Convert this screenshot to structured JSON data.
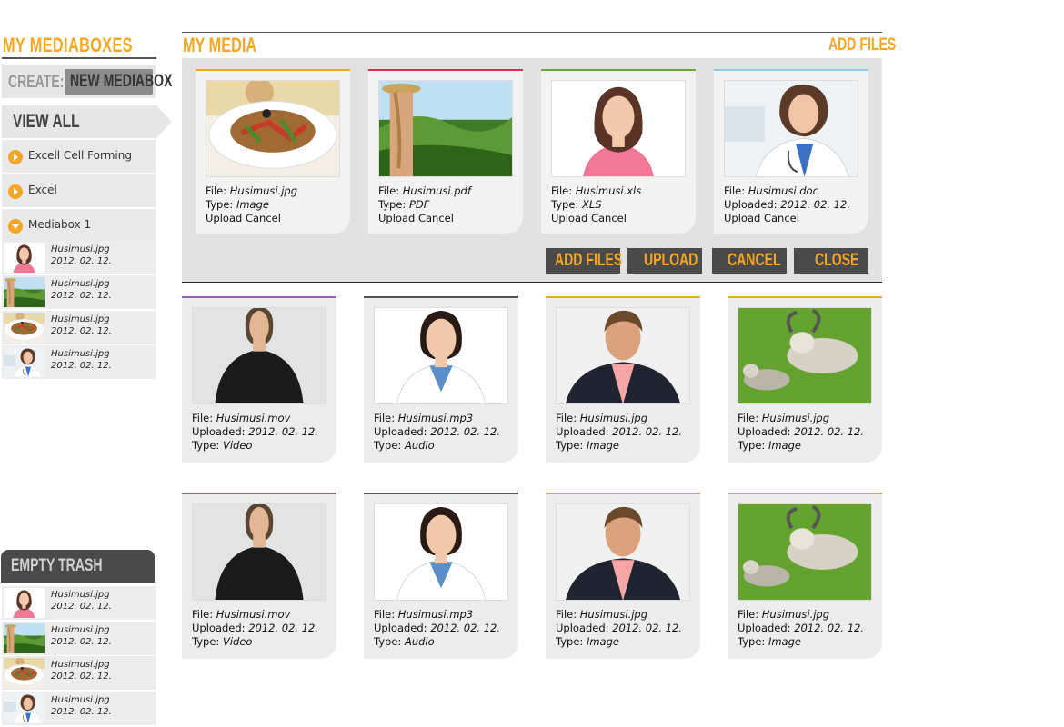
{
  "sidebar": {
    "title": "MY MEDIABOXES",
    "create_label": "CREATE:",
    "new_mediabox_label": "NEW MEDIABOX",
    "view_all_label": "VIEW ALL",
    "folders": [
      {
        "label": "Excell Cell Forming",
        "state": "collapsed"
      },
      {
        "label": "Excel",
        "state": "collapsed"
      },
      {
        "label": "Mediabox 1",
        "state": "expanded"
      }
    ],
    "mediabox_items": [
      {
        "name": "Husimusi.jpg",
        "date": "2012. 02. 12.",
        "thumb": "woman-pink"
      },
      {
        "name": "Husimusi.jpg",
        "date": "2012. 02. 12.",
        "thumb": "landscape"
      },
      {
        "name": "Husimusi.jpg",
        "date": "2012. 02. 12.",
        "thumb": "food"
      },
      {
        "name": "Husimusi.jpg",
        "date": "2012. 02. 12.",
        "thumb": "doctor"
      }
    ],
    "empty_trash_label": "EMPTY TRASH",
    "trash_items": [
      {
        "name": "Husimusi.jpg",
        "date": "2012. 02. 12.",
        "thumb": "woman-pink"
      },
      {
        "name": "Husimusi.jpg",
        "date": "2012. 02. 12.",
        "thumb": "landscape"
      },
      {
        "name": "Husimusi.jpg",
        "date": "2012. 02. 12.",
        "thumb": "food"
      },
      {
        "name": "Husimusi.jpg",
        "date": "2012. 02. 12.",
        "thumb": "doctor"
      }
    ]
  },
  "main": {
    "title": "MY MEDIA",
    "add_files_link": "ADD FILES"
  },
  "upload_panel": {
    "cards": [
      {
        "file_label": "File:",
        "file": "Husimusi.jpg",
        "line2_label": "Type:",
        "line2_value": "Image",
        "upload": "Upload",
        "cancel": "Cancel",
        "accent": "#f5a623",
        "thumb": "food"
      },
      {
        "file_label": "File:",
        "file": "Husimusi.pdf",
        "line2_label": "Type:",
        "line2_value": "PDF",
        "upload": "Upload",
        "cancel": "Cancel",
        "accent": "#d9304a",
        "thumb": "landscape"
      },
      {
        "file_label": "File:",
        "file": "Husimusi.xls",
        "line2_label": "Type:",
        "line2_value": "XLS",
        "upload": "Upload",
        "cancel": "Cancel",
        "accent": "#66aa33",
        "thumb": "woman-pink"
      },
      {
        "file_label": "File:",
        "file": "Husimusi.doc",
        "line2_label": "Uploaded:",
        "line2_value": "2012. 02. 12.",
        "upload": "Upload",
        "cancel": "Cancel",
        "accent": "#88ccee",
        "thumb": "doctor"
      }
    ],
    "buttons": {
      "add_files": "ADD FILES",
      "upload": "UPLOAD",
      "cancel": "CANCEL",
      "close": "CLOSE"
    }
  },
  "media_grid": {
    "rows": [
      [
        {
          "file_label": "File:",
          "file": "Husimusi.mov",
          "uploaded_label": "Uploaded:",
          "uploaded": "2012. 02. 12.",
          "type_label": "Type:",
          "type": "Video",
          "accent": "#9a55d6",
          "thumb": "man-black"
        },
        {
          "file_label": "File:",
          "file": "Husimusi.mp3",
          "uploaded_label": "Uploaded:",
          "uploaded": "2012. 02. 12.",
          "type_label": "Type:",
          "type": "Audio",
          "accent": "#555555",
          "thumb": "nurse"
        },
        {
          "file_label": "File:",
          "file": "Husimusi.jpg",
          "uploaded_label": "Uploaded:",
          "uploaded": "2012. 02. 12.",
          "type_label": "Type:",
          "type": "Image",
          "accent": "#f5a623",
          "thumb": "businessman"
        },
        {
          "file_label": "File:",
          "file": "Husimusi.jpg",
          "uploaded_label": "Uploaded:",
          "uploaded": "2012. 02. 12.",
          "type_label": "Type:",
          "type": "Image",
          "accent": "#f5a623",
          "thumb": "yak"
        }
      ],
      [
        {
          "file_label": "File:",
          "file": "Husimusi.mov",
          "uploaded_label": "Uploaded:",
          "uploaded": "2012. 02. 12.",
          "type_label": "Type:",
          "type": "Video",
          "accent": "#9a55d6",
          "thumb": "man-black"
        },
        {
          "file_label": "File:",
          "file": "Husimusi.mp3",
          "uploaded_label": "Uploaded:",
          "uploaded": "2012. 02. 12.",
          "type_label": "Type:",
          "type": "Audio",
          "accent": "#555555",
          "thumb": "nurse"
        },
        {
          "file_label": "File:",
          "file": "Husimusi.jpg",
          "uploaded_label": "Uploaded:",
          "uploaded": "2012. 02. 12.",
          "type_label": "Type:",
          "type": "Image",
          "accent": "#f5a623",
          "thumb": "businessman"
        },
        {
          "file_label": "File:",
          "file": "Husimusi.jpg",
          "uploaded_label": "Uploaded:",
          "uploaded": "2012. 02. 12.",
          "type_label": "Type:",
          "type": "Image",
          "accent": "#f5a623",
          "thumb": "yak"
        }
      ]
    ]
  },
  "colors": {
    "accent": "#f5a623",
    "dark_button": "#4a4a4a",
    "panel_bg": "#e2e2e2",
    "card_bg": "#ececec"
  }
}
